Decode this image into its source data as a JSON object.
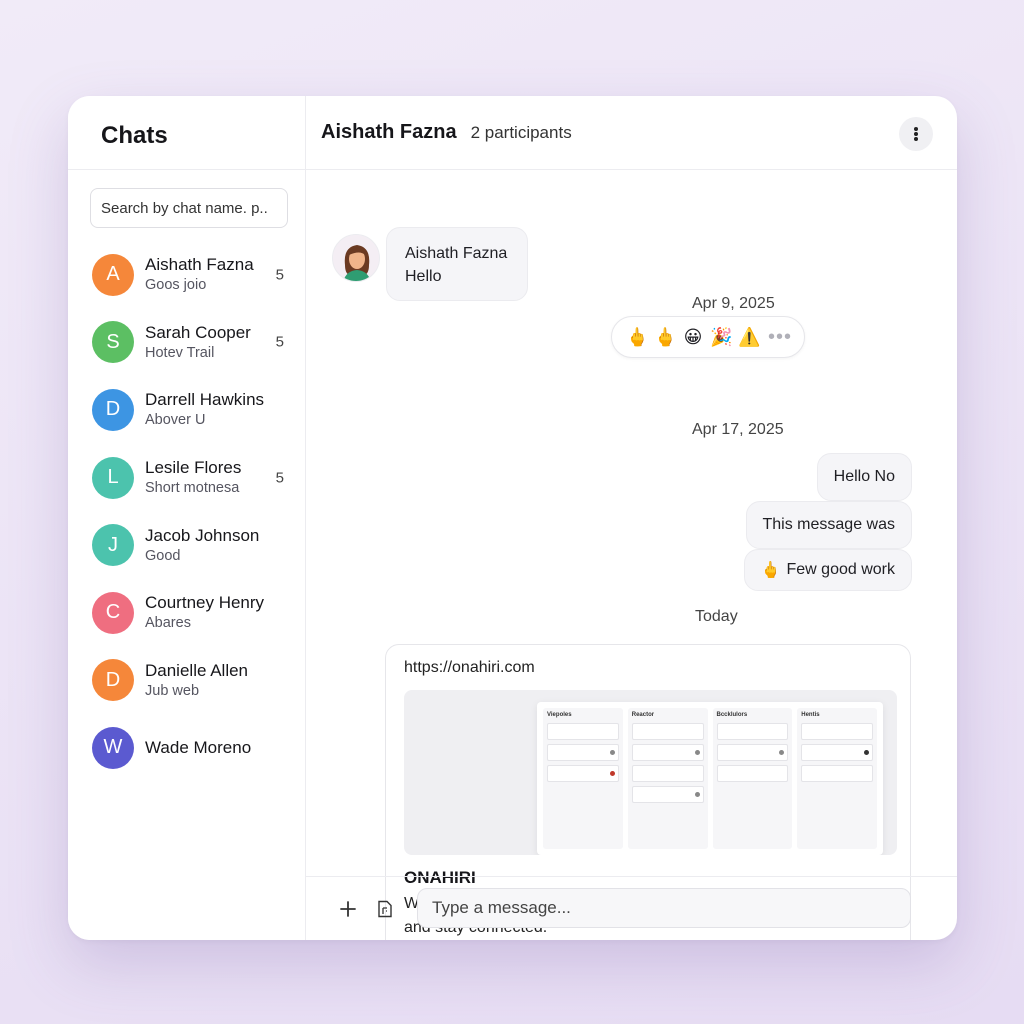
{
  "sidebar": {
    "title": "Chats",
    "search_placeholder": "Search by chat name. p..",
    "chats": [
      {
        "initial": "A",
        "name": "Aishath Fazna",
        "preview": "Goos joio",
        "count": "5",
        "color": "#f5873a"
      },
      {
        "initial": "S",
        "name": "Sarah Cooper",
        "preview": "Hotev Trail",
        "count": "5",
        "color": "#5cbf63"
      },
      {
        "initial": "D",
        "name": "Darrell Hawkins",
        "preview": "Abover U",
        "count": "",
        "color": "#3d95e3"
      },
      {
        "initial": "L",
        "name": "Lesile Flores",
        "preview": "Short motnesa",
        "count": "5",
        "color": "#4cc3ad"
      },
      {
        "initial": "J",
        "name": "Jacob Johnson",
        "preview": "Good",
        "count": "",
        "color": "#4cc3ad"
      },
      {
        "initial": "C",
        "name": "Courtney Henry",
        "preview": "Abares",
        "count": "",
        "color": "#ef6e80"
      },
      {
        "initial": "D",
        "name": "Danielle Allen",
        "preview": "Jub web",
        "count": "",
        "color": "#f5873a"
      },
      {
        "initial": "W",
        "name": "Wade Moreno",
        "preview": "",
        "count": "",
        "color": "#5b5ad0"
      }
    ]
  },
  "header": {
    "name": "Aishath Fazna",
    "participants": "2 participants",
    "menu_icon": "more-vertical-icon"
  },
  "messages": {
    "date_1": "Apr 9, 2025",
    "incoming": {
      "sender": "Aishath Fazna",
      "text": "Hello"
    },
    "reactions": [
      "🖕",
      "🖕",
      "😀",
      "🎉",
      "⚠️"
    ],
    "date_2": "Apr 17, 2025",
    "outgoing": [
      "Hello No",
      "This message was",
      "Few good work"
    ],
    "outgoing_3_emoji": "🖕",
    "date_3": "Today",
    "link_preview": {
      "url": "https://onahiri.com",
      "title": "ONAHIRI",
      "description": "Where teams can manage-work-effficiently, collaborate seamelessly and stay connected.",
      "board_columns": [
        "Viepoles",
        "Reactor",
        "Bccklulors",
        "Hentis"
      ]
    }
  },
  "composer": {
    "placeholder": "Type a message..."
  }
}
